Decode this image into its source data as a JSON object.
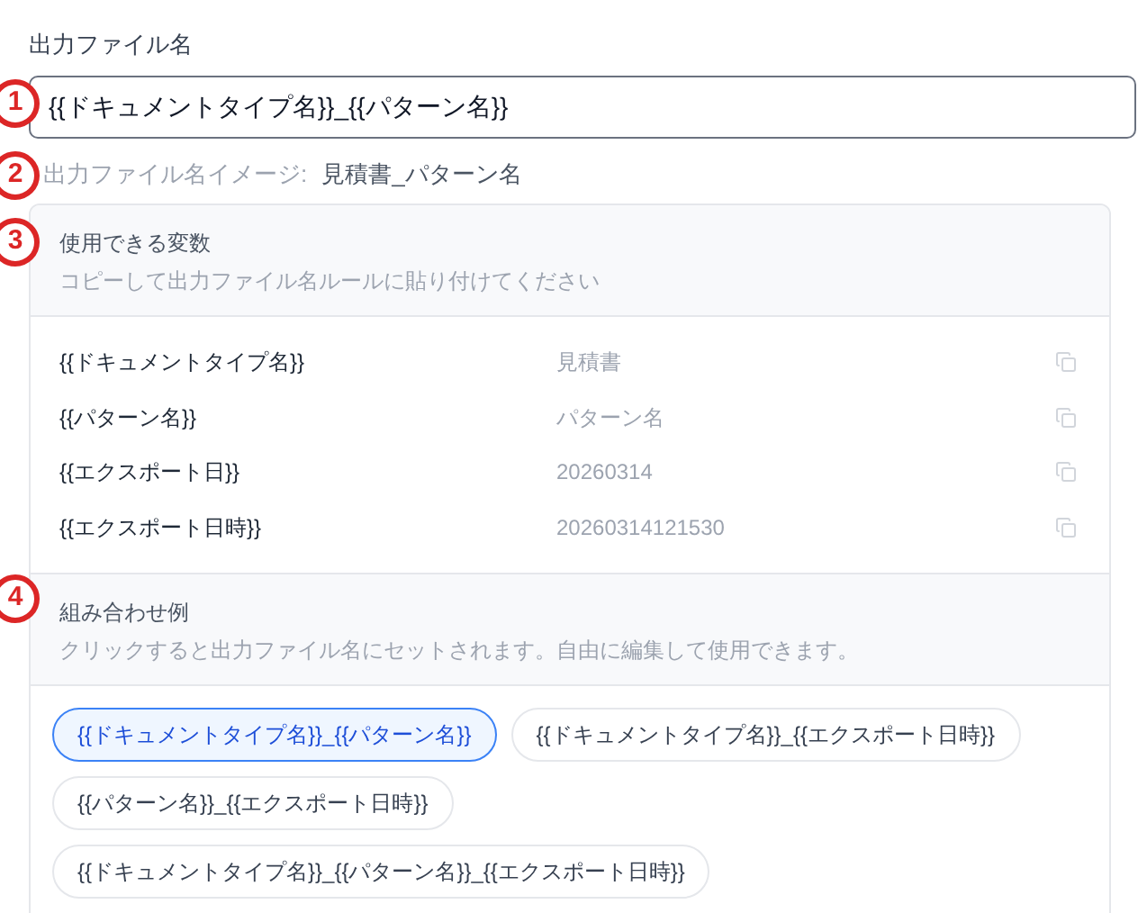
{
  "field": {
    "label": "出力ファイル名",
    "value": "{{ドキュメントタイプ名}}_{{パターン名}}"
  },
  "preview": {
    "label": "出力ファイル名イメージ:",
    "value": "見積書_パターン名"
  },
  "variables": {
    "title": "使用できる変数",
    "hint": "コピーして出力ファイル名ルールに貼り付けてください",
    "rows": [
      {
        "name": "{{ドキュメントタイプ名}}",
        "example": "見積書"
      },
      {
        "name": "{{パターン名}}",
        "example": "パターン名"
      },
      {
        "name": "{{エクスポート日}}",
        "example": "20260314"
      },
      {
        "name": "{{エクスポート日時}}",
        "example": "20260314121530"
      }
    ]
  },
  "examples": {
    "title": "組み合わせ例",
    "hint": "クリックすると出力ファイル名にセットされます。自由に編集して使用できます。",
    "chips": [
      {
        "label": "{{ドキュメントタイプ名}}_{{パターン名}}",
        "selected": true
      },
      {
        "label": "{{ドキュメントタイプ名}}_{{エクスポート日時}}",
        "selected": false
      },
      {
        "label": "{{パターン名}}_{{エクスポート日時}}",
        "selected": false
      },
      {
        "label": "{{ドキュメントタイプ名}}_{{パターン名}}_{{エクスポート日時}}",
        "selected": false
      }
    ]
  },
  "markers": [
    "1",
    "2",
    "3",
    "4"
  ]
}
